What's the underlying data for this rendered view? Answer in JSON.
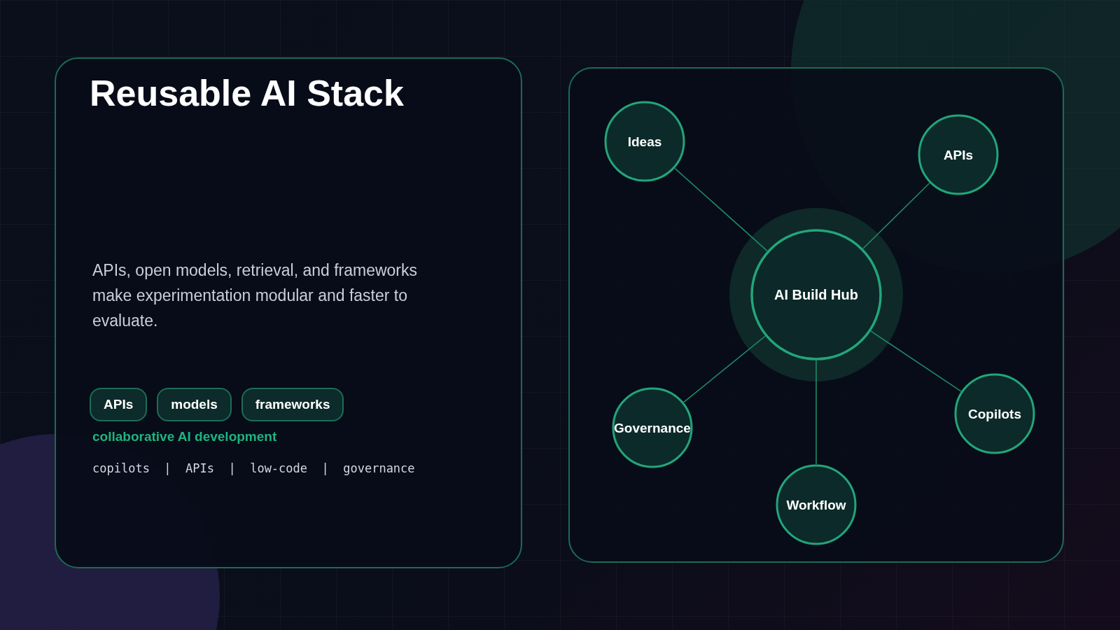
{
  "intro": {
    "title": "Reusable AI Stack",
    "description": "APIs, open models, retrieval, and frameworks make experimentation modular and faster to evaluate.",
    "chips": [
      "APIs",
      "models",
      "frameworks"
    ],
    "tagline": "collaborative AI development",
    "keywords": "copilots  |  APIs  |  low-code  |  governance"
  },
  "diagram": {
    "hub": "AI Build Hub",
    "nodes": [
      {
        "label": "Ideas"
      },
      {
        "label": "APIs"
      },
      {
        "label": "Governance"
      },
      {
        "label": "Copilots"
      },
      {
        "label": "Workflow"
      }
    ]
  }
}
